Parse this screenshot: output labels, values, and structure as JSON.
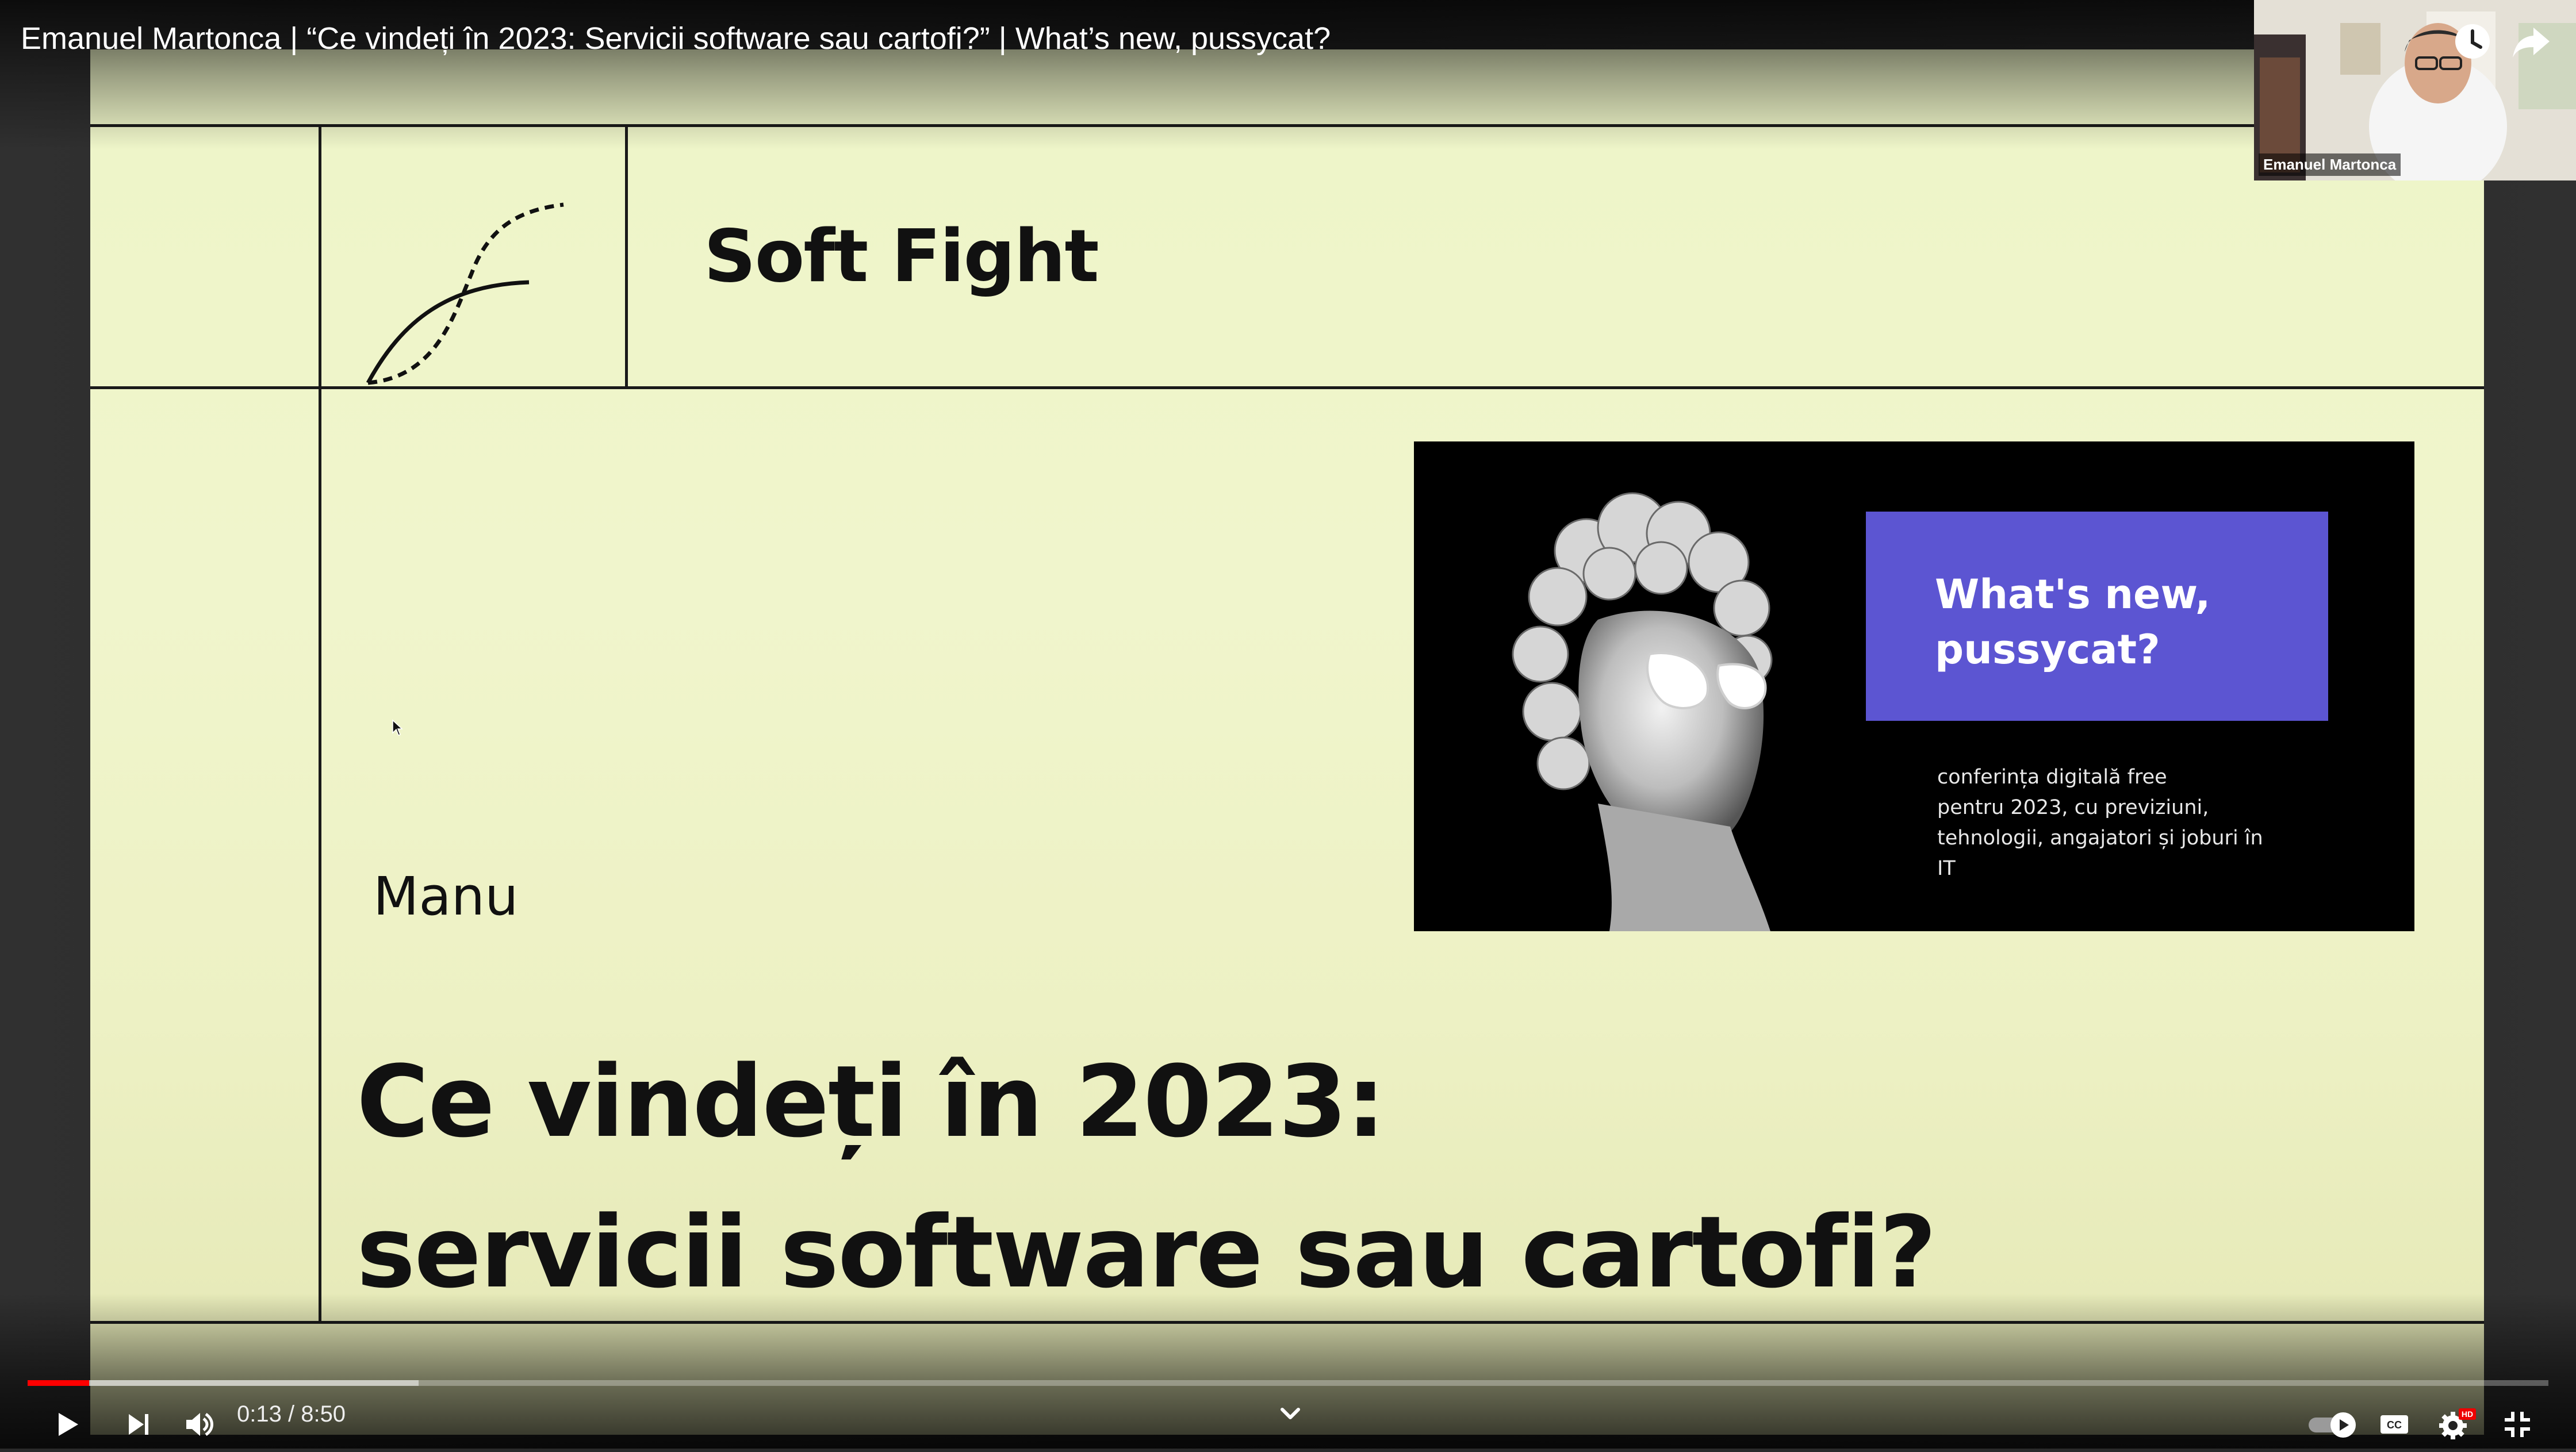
{
  "video": {
    "title": "Emanuel Martonca | “Ce vindeți în 2023: Servicii software sau cartofi?” | What’s new, pussycat?"
  },
  "slide": {
    "brand": "Soft Fight",
    "speaker": "Manu",
    "headline_line1": "Ce vindeți în 2023:",
    "headline_line2": "servicii software sau cartofi?",
    "promo": {
      "title_line1": "What's new,",
      "title_line2": "pussycat?",
      "description_lines": [
        "conferința digitală free",
        "pentru 2023, cu previziuni,",
        "tehnologii, angajatori și joburi în",
        "IT"
      ],
      "box_color": "#5c55d2"
    }
  },
  "speaker_cam": {
    "label": "Emanuel Martonca"
  },
  "controls": {
    "current_time": "0:13",
    "separator": " / ",
    "duration": "8:50",
    "progress_fraction": 0.0245,
    "buffered_fraction": 0.155,
    "icons": [
      "play-icon",
      "next-icon",
      "volume-icon",
      "chevron-down-icon",
      "autoplay-toggle-icon",
      "captions-icon",
      "settings-icon",
      "exit-fullscreen-icon",
      "watch-later-icon",
      "share-icon"
    ],
    "hd_badge": "HD",
    "cc_label": "CC"
  },
  "colors": {
    "progress": "#ff0000",
    "slide_bg": "#eef5c8",
    "promo_box": "#5c55d2"
  }
}
